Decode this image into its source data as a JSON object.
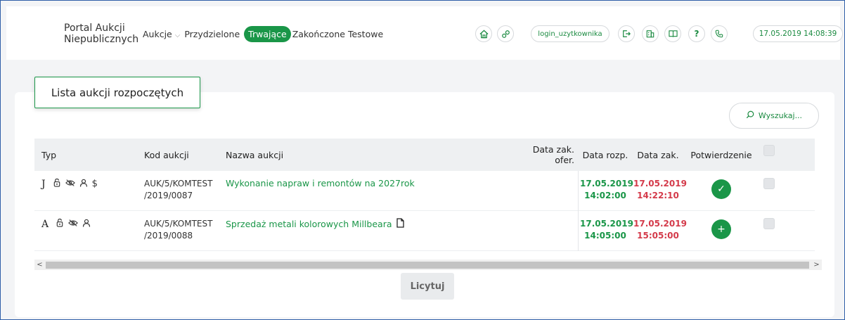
{
  "header": {
    "brand_line1": "Portal Aukcji",
    "brand_line2": "Niepublicznych",
    "nav": [
      {
        "label": "Aukcje",
        "has_dropdown": true
      },
      {
        "label": "Przydzielone",
        "has_dropdown": false
      },
      {
        "label": "Trwające",
        "has_dropdown": false,
        "active": true
      },
      {
        "label": "Zakończone",
        "has_dropdown": false
      },
      {
        "label": "Testowe",
        "has_dropdown": false
      }
    ],
    "login": "login_uzytkownika",
    "datetime": "17.05.2019 14:08:39"
  },
  "card": {
    "title": "Lista aukcji rozpoczętych",
    "search_label": "Wyszukaj..."
  },
  "table": {
    "headers": {
      "typ": "Typ",
      "kod": "Kod aukcji",
      "nazwa": "Nazwa aukcji",
      "data_zak_ofer": "Data zak. ofer.",
      "data_rozp": "Data rozp.",
      "data_zak": "Data zak.",
      "potwierdzenie": "Potwierdzenie"
    },
    "rows": [
      {
        "typ": "J",
        "kod_line1": "AUK/5/KOMTEST",
        "kod_line2": "/2019/0087",
        "nazwa": "Wykonanie napraw i remontów na 2027rok",
        "rozp_date": "17.05.2019",
        "rozp_time": "14:02:00",
        "zak_date": "17.05.2019",
        "zak_time": "14:22:10",
        "potwierdzenie_icon": "✓"
      },
      {
        "typ": "A",
        "kod_line1": "AUK/5/KOMTEST",
        "kod_line2": "/2019/0088",
        "nazwa": "Sprzedaż metali kolorowych Millbeara",
        "rozp_date": "17.05.2019",
        "rozp_time": "14:05:00",
        "zak_date": "17.05.2019",
        "zak_time": "15:05:00",
        "potwierdzenie_icon": "+"
      }
    ]
  },
  "buttons": {
    "licytuj": "Licytuj"
  },
  "colors": {
    "accent": "#1a9648",
    "date_red": "#d43a4a"
  }
}
